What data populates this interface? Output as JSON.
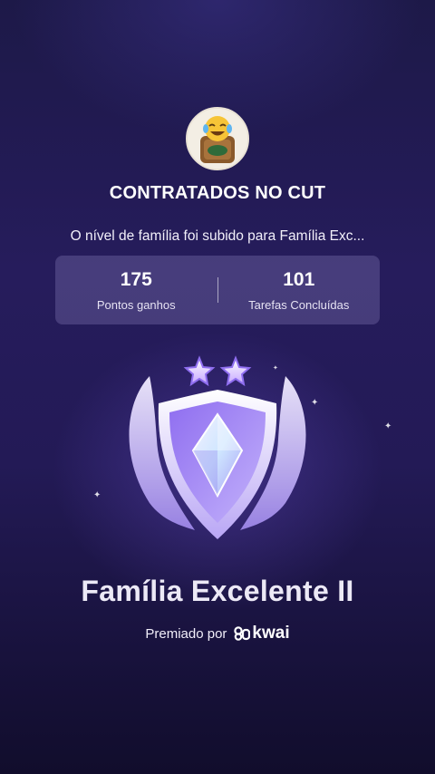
{
  "group": {
    "name": "CONTRATADOS NO CUT",
    "avatar_icon": "crying-laughing-emoji-avatar"
  },
  "message": "O nível de família foi subido para Família Exc...",
  "stats": [
    {
      "value": "175",
      "label": "Pontos ganhos"
    },
    {
      "value": "101",
      "label": "Tarefas Concluídas"
    }
  ],
  "badge": {
    "title": "Família Excelente II",
    "stars": 2,
    "icon": "shield-crystal-badge-icon"
  },
  "awarded": {
    "prefix": "Premiado por",
    "brand": "kwai"
  },
  "colors": {
    "background_top": "#1d1948",
    "background_bottom": "#110d2c",
    "stats_panel": "#5f5a8c",
    "badge_accent": "#b79cff"
  }
}
